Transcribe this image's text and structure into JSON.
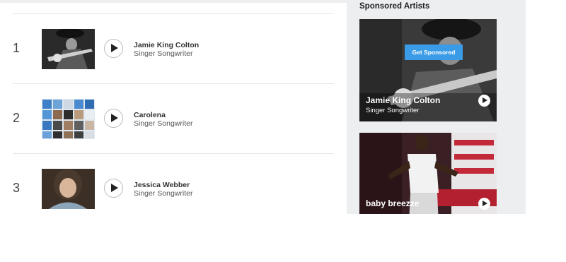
{
  "chart_list": [
    {
      "rank": "1",
      "name": "Jamie King Colton",
      "role": "Singer Songwriter"
    },
    {
      "rank": "2",
      "name": "Carolena",
      "role": "Singer Songwriter"
    },
    {
      "rank": "3",
      "name": "Jessica Webber",
      "role": "Singer Songwriter"
    }
  ],
  "sidebar": {
    "title": "Sponsored Artists",
    "cards": [
      {
        "name": "Jamie King Colton",
        "role": "Singer Songwriter",
        "cta": "Get Sponsored"
      },
      {
        "name": "baby breezze",
        "role": ""
      }
    ]
  },
  "colors": {
    "accent": "#3a9be6",
    "sidebar_bg": "#eceeef"
  }
}
